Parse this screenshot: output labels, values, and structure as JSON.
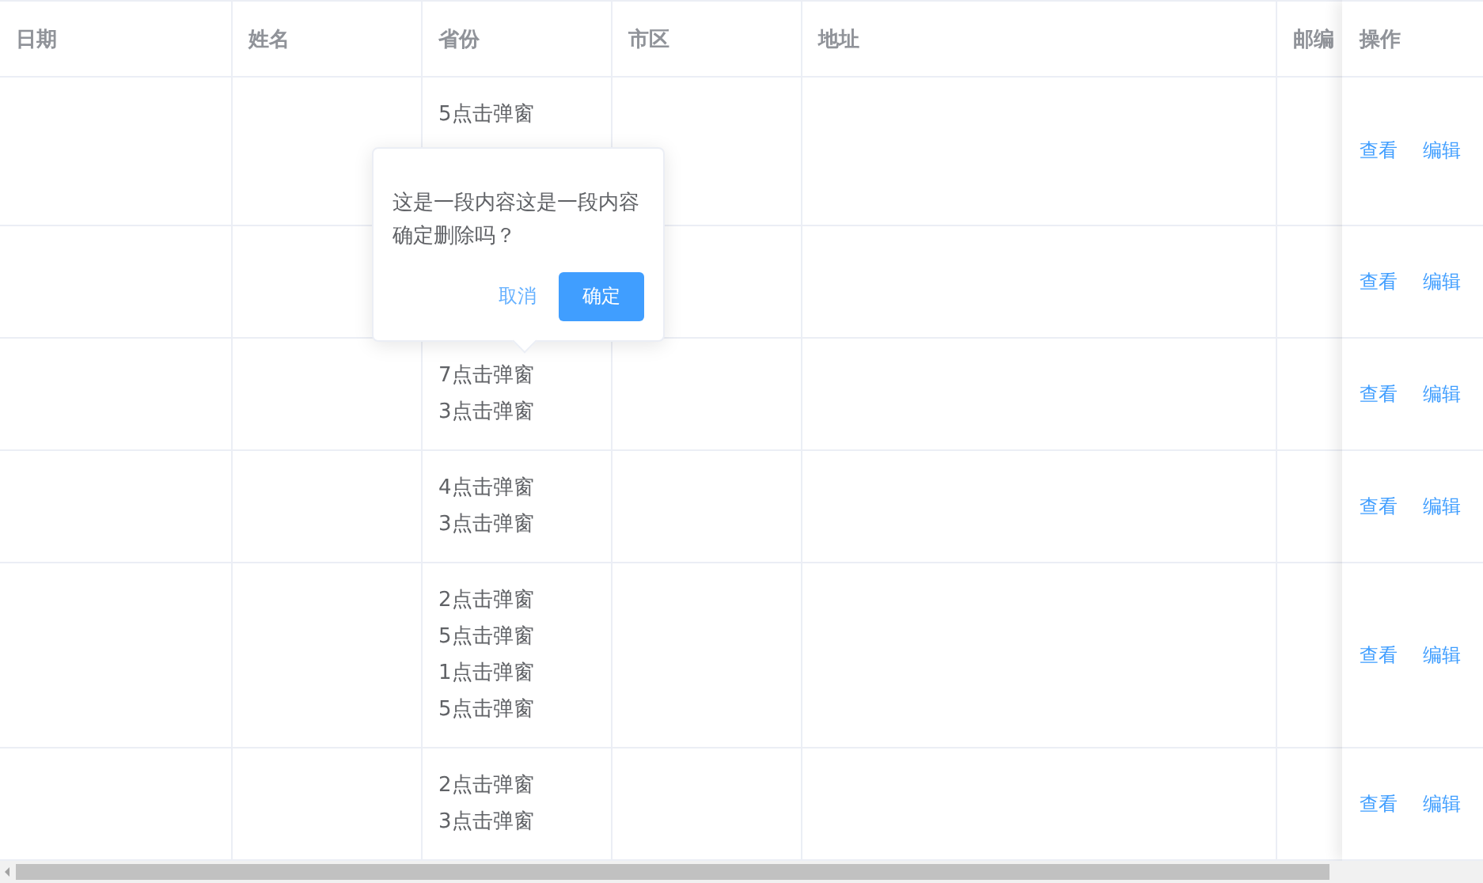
{
  "table": {
    "columns": [
      "日期",
      "姓名",
      "省份",
      "市区",
      "地址",
      "邮编"
    ],
    "rows": [
      {
        "province_lines": [
          "5点击弹窗"
        ],
        "actions": [
          "查看",
          "编辑"
        ]
      },
      {
        "province_lines": [],
        "actions": [
          "查看",
          "编辑"
        ]
      },
      {
        "province_lines": [
          "7点击弹窗",
          "3点击弹窗"
        ],
        "actions": [
          "查看",
          "编辑"
        ]
      },
      {
        "province_lines": [
          "4点击弹窗",
          "3点击弹窗"
        ],
        "actions": [
          "查看",
          "编辑"
        ]
      },
      {
        "province_lines": [
          "2点击弹窗",
          "5点击弹窗",
          "1点击弹窗",
          "5点击弹窗"
        ],
        "actions": [
          "查看",
          "编辑"
        ]
      },
      {
        "province_lines": [
          "2点击弹窗",
          "3点击弹窗"
        ],
        "actions": [
          "查看",
          "编辑"
        ]
      }
    ],
    "fixed_column": "操作"
  },
  "popover": {
    "message": "这是一段内容这是一段内容确定删除吗？",
    "cancel": "取消",
    "confirm": "确定"
  }
}
